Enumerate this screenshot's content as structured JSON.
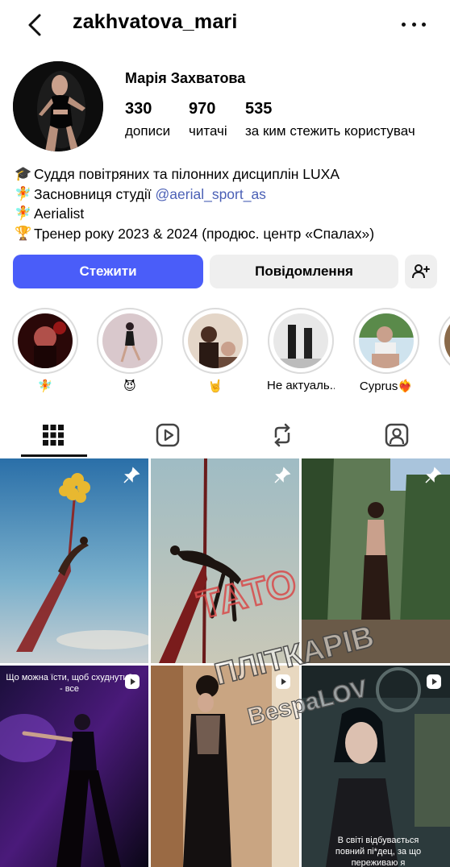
{
  "header": {
    "username": "zakhvatova_mari"
  },
  "profile": {
    "full_name": "Марія Захватова",
    "stats": [
      {
        "value": "330",
        "label": "дописи"
      },
      {
        "value": "970",
        "label": "читачі"
      },
      {
        "value": "535",
        "label": "за ким стежить користувач"
      }
    ],
    "bio": [
      {
        "emoji": "🎓",
        "text": "Суддя повітряних та пілонних дисциплін  LUXA",
        "link": ""
      },
      {
        "emoji": "🧚",
        "text": "Засновниця студії ",
        "link": "@aerial_sport_as"
      },
      {
        "emoji": "🧚",
        "text": "Aerialist",
        "link": ""
      },
      {
        "emoji": "🏆",
        "text": "Тренер року 2023 & 2024 (продюс.  центр «Спалах»)",
        "link": ""
      }
    ]
  },
  "actions": {
    "follow_label": "Стежити",
    "message_label": "Повідомлення"
  },
  "highlights": [
    {
      "label": "🧚"
    },
    {
      "label": "😈"
    },
    {
      "label": "🤘"
    },
    {
      "label": "Не актуаль..."
    },
    {
      "label": "Cyprus❤️‍🔥"
    }
  ],
  "grid": {
    "captions": {
      "post4": "Що можна їсти, щоб схуднути? - все",
      "post6": "В світі відбувається повний пі*дец, за що переживаю я"
    }
  },
  "watermark": {
    "line1": "ТАТО",
    "line2": "ПЛІТКАРІВ",
    "line3": "BespaLOV"
  },
  "colors": {
    "accent": "#4a5df9",
    "link": "#4a5fb5",
    "secondary_button": "#efefef"
  }
}
